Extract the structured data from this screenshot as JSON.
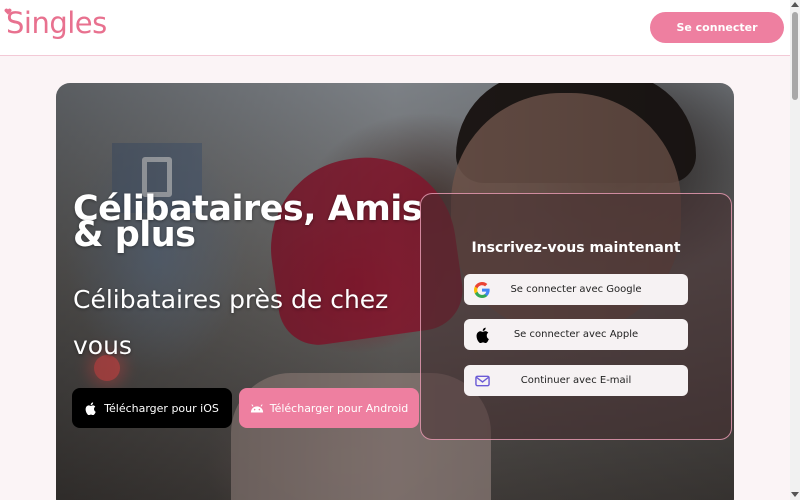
{
  "header": {
    "logo_text": "Singles",
    "login_label": "Se connecter"
  },
  "hero": {
    "title": "Célibataires, Amis & plus",
    "subtitle": "Célibataires près de chez vous",
    "ios_label": "Télécharger pour iOS",
    "android_label": "Télécharger pour Android"
  },
  "signup": {
    "title": "Inscrivez-vous maintenant",
    "google_label": "Se connecter avec Google",
    "apple_label": "Se connecter avec Apple",
    "email_label": "Continuer avec E-mail"
  },
  "icons": {
    "brand_heart": "heart-icon",
    "ios": "apple-icon",
    "android": "android-icon",
    "google": "google-icon",
    "apple": "apple-icon",
    "email": "mail-icon"
  },
  "colors": {
    "brand": "#ee7fa0",
    "logo": "#e8718f",
    "panel_border": "#f0a0b9"
  }
}
